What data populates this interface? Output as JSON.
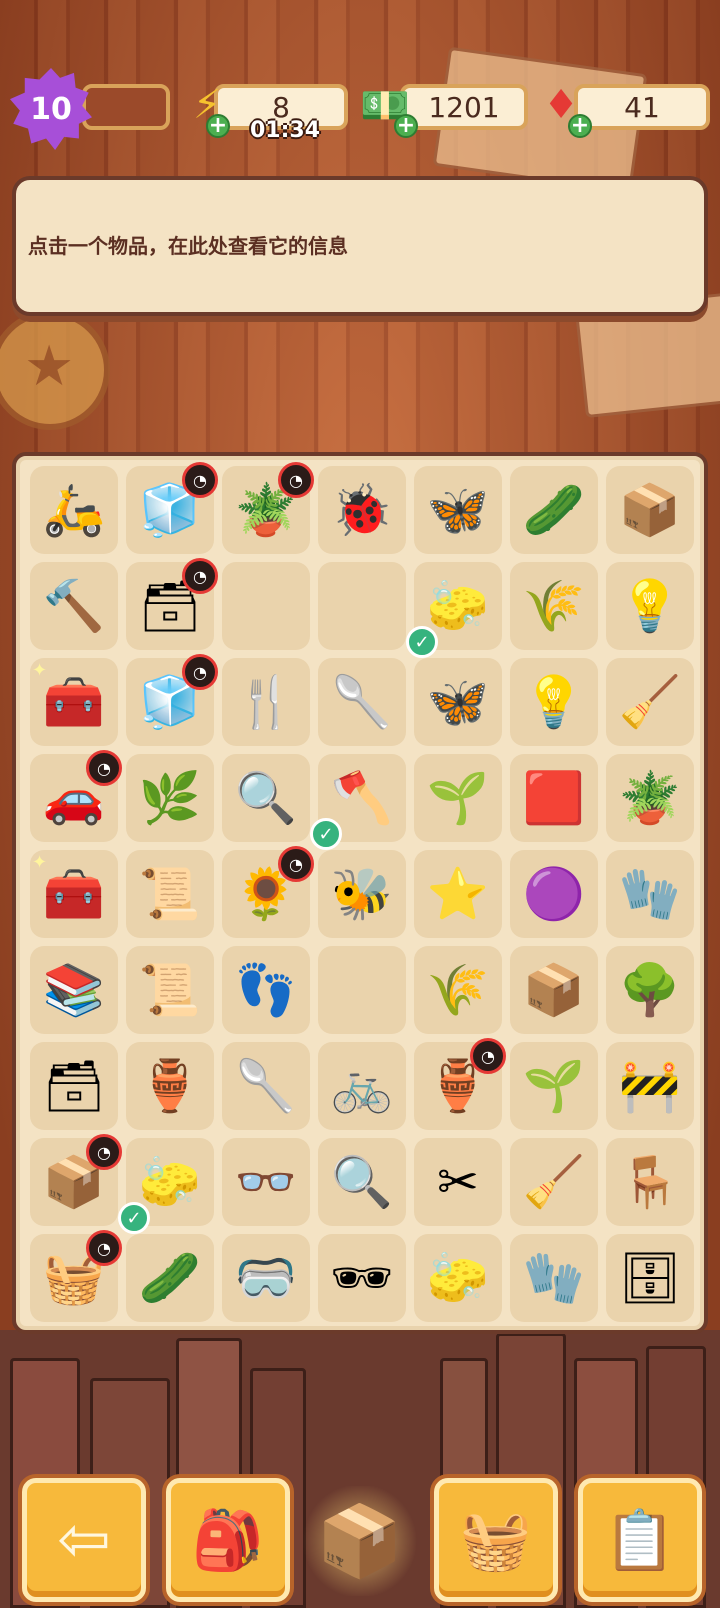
{
  "topbar": {
    "level": "10",
    "energy": {
      "value": "8",
      "timer": "01:34",
      "icon": "lightning-icon"
    },
    "cash": {
      "value": "1201",
      "icon": "cash-stack-icon"
    },
    "gems": {
      "value": "41",
      "icon": "ruby-gem-icon"
    }
  },
  "info": {
    "text": "点击一个物品，在此处查看它的信息"
  },
  "board": {
    "cells": [
      {
        "icon": "🛵",
        "name": "scooter"
      },
      {
        "icon": "🧊",
        "name": "gift-cube",
        "timer": true
      },
      {
        "icon": "🪴",
        "name": "plant-pot",
        "timer": true
      },
      {
        "icon": "🐞",
        "name": "ladybug"
      },
      {
        "icon": "🦋",
        "name": "butterflies"
      },
      {
        "icon": "🥒",
        "name": "cucumber-slice"
      },
      {
        "icon": "📦",
        "name": "boxes"
      },
      {
        "icon": "🔨",
        "name": "hammer"
      },
      {
        "icon": "🗃",
        "name": "evidence-box",
        "timer": true
      },
      {
        "icon": "",
        "name": "empty",
        "empty": true
      },
      {
        "icon": "",
        "name": "empty",
        "empty": true
      },
      {
        "icon": "🧽",
        "name": "green-sponge",
        "check": true
      },
      {
        "icon": "🌾",
        "name": "seeds"
      },
      {
        "icon": "💡",
        "name": "lamp"
      },
      {
        "icon": "🧰",
        "name": "red-toolbox",
        "sparkle": true
      },
      {
        "icon": "🧊",
        "name": "gift-cube",
        "timer": true
      },
      {
        "icon": "🍴",
        "name": "garden-fork"
      },
      {
        "icon": "🥄",
        "name": "trowel"
      },
      {
        "icon": "🦋",
        "name": "moth"
      },
      {
        "icon": "💡",
        "name": "light-bulb"
      },
      {
        "icon": "🧹",
        "name": "rake"
      },
      {
        "icon": "🚗",
        "name": "car",
        "timer": true
      },
      {
        "icon": "🌿",
        "name": "sprout"
      },
      {
        "icon": "🔍",
        "name": "magnifier"
      },
      {
        "icon": "🪓",
        "name": "axe",
        "check": true
      },
      {
        "icon": "🌱",
        "name": "seed-packet"
      },
      {
        "icon": "🟥",
        "name": "red-tray"
      },
      {
        "icon": "🪴",
        "name": "potted-plant"
      },
      {
        "icon": "🧰",
        "name": "white-toolbox",
        "sparkle": true
      },
      {
        "icon": "📜",
        "name": "map-papers"
      },
      {
        "icon": "🌻",
        "name": "planter",
        "timer": true
      },
      {
        "icon": "🐝",
        "name": "purple-bee"
      },
      {
        "icon": "⭐",
        "name": "purple-star"
      },
      {
        "icon": "🟣",
        "name": "purple-blob"
      },
      {
        "icon": "🧤",
        "name": "red-glove"
      },
      {
        "icon": "📚",
        "name": "papers-stack"
      },
      {
        "icon": "📜",
        "name": "papers-pile"
      },
      {
        "icon": "👣",
        "name": "footprint-bag"
      },
      {
        "icon": "",
        "name": "empty",
        "empty": true
      },
      {
        "icon": "🌾",
        "name": "seeds"
      },
      {
        "icon": "📦",
        "name": "boxes"
      },
      {
        "icon": "🌳",
        "name": "bonsai"
      },
      {
        "icon": "🗃",
        "name": "evidence-box"
      },
      {
        "icon": "🏺",
        "name": "vase"
      },
      {
        "icon": "🥄",
        "name": "shovel"
      },
      {
        "icon": "🚲",
        "name": "bicycle"
      },
      {
        "icon": "🏺",
        "name": "jug",
        "timer": true
      },
      {
        "icon": "🌱",
        "name": "seedling"
      },
      {
        "icon": "🚧",
        "name": "barrier"
      },
      {
        "icon": "📦",
        "name": "open-box",
        "timer": true
      },
      {
        "icon": "🧽",
        "name": "green-sponge",
        "check": true
      },
      {
        "icon": "👓",
        "name": "goggles"
      },
      {
        "icon": "🔍",
        "name": "magnifying-glass"
      },
      {
        "icon": "✂",
        "name": "pruning-shears"
      },
      {
        "icon": "🧹",
        "name": "broom"
      },
      {
        "icon": "🪑",
        "name": "chair"
      },
      {
        "icon": "🧺",
        "name": "treasure-box",
        "timer": true
      },
      {
        "icon": "🥒",
        "name": "green-bottle"
      },
      {
        "icon": "🥽",
        "name": "diving-goggles"
      },
      {
        "icon": "🕶",
        "name": "sunglasses"
      },
      {
        "icon": "🧽",
        "name": "sponge"
      },
      {
        "icon": "🧤",
        "name": "gloves"
      },
      {
        "icon": "🗄",
        "name": "desk"
      }
    ]
  },
  "buttons": [
    {
      "name": "back-button",
      "icon": "⇦"
    },
    {
      "name": "backpack-button",
      "icon": "🎒"
    },
    {
      "name": "center-box-button",
      "icon": "📦"
    },
    {
      "name": "basket-button",
      "icon": "🧺"
    },
    {
      "name": "clipboard-button",
      "icon": "📋"
    }
  ]
}
